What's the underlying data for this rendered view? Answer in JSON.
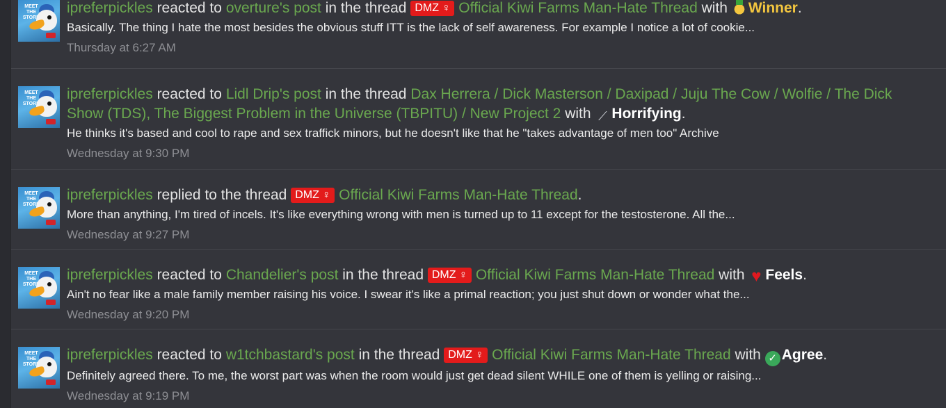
{
  "activity": [
    {
      "user": "ipreferpickles",
      "action": "reacted to",
      "target": "overture's post",
      "in_thread": "in the thread",
      "prefix": "DMZ ♀",
      "thread": "Official Kiwi Farms Man-Hate Thread",
      "with": "with",
      "reaction_icon": "medal-icon",
      "reaction": "Winner",
      "end": ".",
      "snippet": "Basically. The thing I hate the most besides the obvious stuff ITT is the lack of self awareness. For example I notice a lot of cookie...",
      "time": "Thursday at 6:27 AM"
    },
    {
      "user": "ipreferpickles",
      "action": "reacted to",
      "target": "Lidl Drip's post",
      "in_thread": "in the thread",
      "thread": "Dax Herrera / Dick Masterson / Daxipad / Juju The Cow / Wolfie / The Dick Show (TDS), The Biggest Problem in the Universe (TBPITU) / New Project 2",
      "with": "with",
      "reaction_icon": "bone-icon",
      "reaction": "Horrifying",
      "end": ".",
      "snippet": "He thinks it's based and cool to rape and sex traffick minors, but he doesn't like that he \"takes advantage of men too\" Archive",
      "time": "Wednesday at 9:30 PM"
    },
    {
      "user": "ipreferpickles",
      "action": "replied to the thread",
      "prefix": "DMZ ♀",
      "thread": "Official Kiwi Farms Man-Hate Thread",
      "end": ".",
      "snippet": "More than anything, I'm tired of incels. It's like everything wrong with men is turned up to 11 except for the testosterone. All the...",
      "time": "Wednesday at 9:27 PM"
    },
    {
      "user": "ipreferpickles",
      "action": "reacted to",
      "target": "Chandelier's post",
      "in_thread": "in the thread",
      "prefix": "DMZ ♀",
      "thread": "Official Kiwi Farms Man-Hate Thread",
      "with": "with",
      "reaction_icon": "heart-icon",
      "reaction": "Feels",
      "end": ".",
      "snippet": "Ain't no fear like a male family member raising his voice. I swear it's like a primal reaction; you just shut down or wonder what the...",
      "time": "Wednesday at 9:20 PM"
    },
    {
      "user": "ipreferpickles",
      "action": "reacted to",
      "target": "w1tchbastard's post",
      "in_thread": "in the thread",
      "prefix": "DMZ ♀",
      "thread": "Official Kiwi Farms Man-Hate Thread",
      "with": "with",
      "reaction_icon": "check-icon",
      "reaction": "Agree",
      "end": ".",
      "snippet": "Definitely agreed there. To me, the worst part was when the room would just get dead silent WHILE one of them is yelling or raising...",
      "time": "Wednesday at 9:19 PM"
    }
  ],
  "avatar": {
    "text": "MEET THE STORK"
  },
  "colors": {
    "link": "#6aa84f",
    "prefix_bg": "#e31b1b",
    "winner": "#f3c63f",
    "background": "#34353b"
  }
}
